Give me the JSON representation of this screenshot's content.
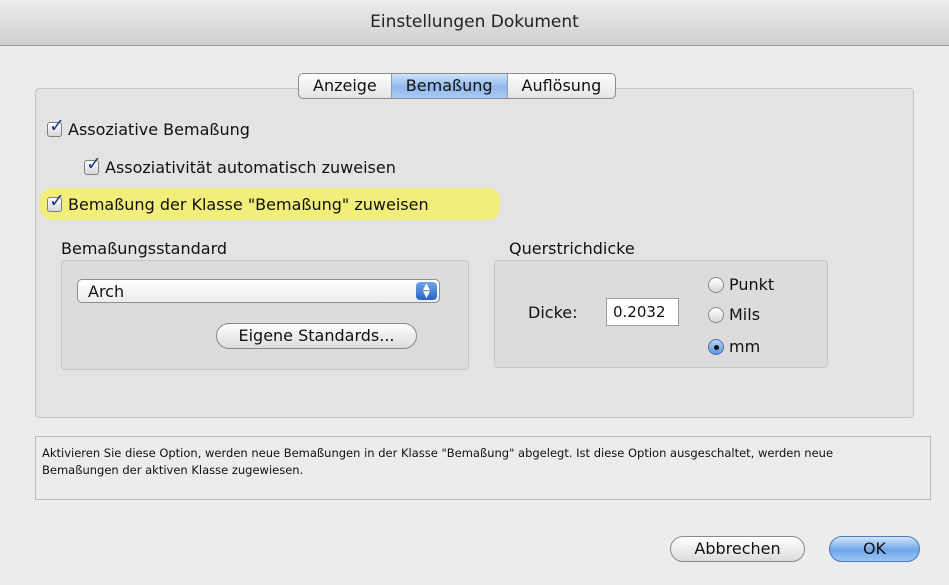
{
  "window": {
    "title": "Einstellungen Dokument"
  },
  "tabs": [
    {
      "label": "Anzeige",
      "active": false
    },
    {
      "label": "Bemaßung",
      "active": true
    },
    {
      "label": "Auflösung",
      "active": false
    }
  ],
  "options": {
    "associative": {
      "label": "Assoziative Bemaßung",
      "checked": true
    },
    "auto_assign": {
      "label": "Assoziativität automatisch zuweisen",
      "checked": true
    },
    "class_assign": {
      "label": "Bemaßung der Klasse \"Bemaßung\" zuweisen",
      "checked": true
    }
  },
  "standard": {
    "group_label": "Bemaßungsstandard",
    "selected": "Arch",
    "custom_button": "Eigene Standards..."
  },
  "crossbar": {
    "group_label": "Querstrichdicke",
    "thickness_label": "Dicke:",
    "thickness_value": "0.2032",
    "units": [
      {
        "label": "Punkt",
        "selected": false
      },
      {
        "label": "Mils",
        "selected": false
      },
      {
        "label": "mm",
        "selected": true
      }
    ]
  },
  "help": {
    "line1": "Aktivieren Sie diese Option, werden neue Bemaßungen in der Klasse \"Bemaßung\" abgelegt. Ist diese Option ausgeschaltet, werden neue",
    "line2": "Bemaßungen der aktiven Klasse zugewiesen."
  },
  "buttons": {
    "cancel": "Abbrechen",
    "ok": "OK"
  },
  "colors": {
    "highlight": "#f2ee7a",
    "accent": "#6fa6ea"
  }
}
